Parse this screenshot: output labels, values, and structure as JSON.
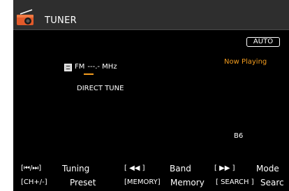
{
  "header": {
    "title": "TUNER",
    "icon": "radio-icon"
  },
  "status": {
    "mode_badge": "AUTO",
    "now_playing": "Now Playing"
  },
  "tuner": {
    "band_icon": "band-icon",
    "band": "FM",
    "frequency": "---.- MHz",
    "input_mode": "DIRECT TUNE",
    "preset": "B6"
  },
  "help": {
    "row1": [
      {
        "key": "[⏮/⏭]",
        "label": "Tuning"
      },
      {
        "key": "[ ◀◀ ]",
        "label": "Band"
      },
      {
        "key": "[ ▶▶ ]",
        "label": "Mode"
      }
    ],
    "row2": [
      {
        "key": "[CH+/-]",
        "label": "Preset"
      },
      {
        "key": "[MEMORY]",
        "label": "Memory"
      },
      {
        "key": "[ SEARCH ]",
        "label": "Searc"
      }
    ]
  },
  "colors": {
    "accent": "#f39c1e",
    "background": "#000000",
    "header": "#2e2e2e"
  }
}
